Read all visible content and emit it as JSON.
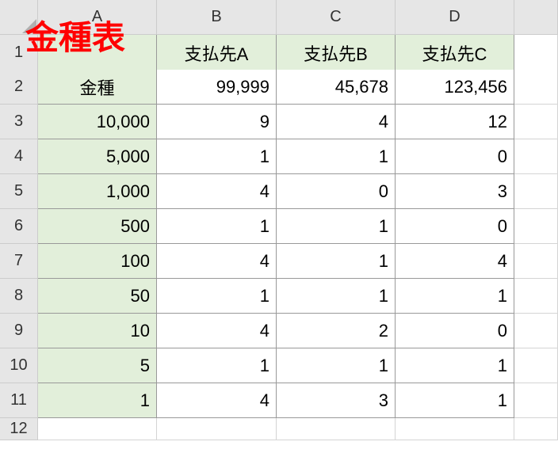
{
  "overlay_title": "金種表",
  "col_headers": [
    "A",
    "B",
    "C",
    "D"
  ],
  "row_headers": [
    "1",
    "2",
    "3",
    "4",
    "5",
    "6",
    "7",
    "8",
    "9",
    "10",
    "11",
    "12"
  ],
  "cells": {
    "B1": "支払先A",
    "C1": "支払先B",
    "D1": "支払先C",
    "A2": "金種",
    "B2": "99,999",
    "C2": "45,678",
    "D2": "123,456",
    "A3": "10,000",
    "B3": "9",
    "C3": "4",
    "D3": "12",
    "A4": "5,000",
    "B4": "1",
    "C4": "1",
    "D4": "0",
    "A5": "1,000",
    "B5": "4",
    "C5": "0",
    "D5": "3",
    "A6": "500",
    "B6": "1",
    "C6": "1",
    "D6": "0",
    "A7": "100",
    "B7": "4",
    "C7": "1",
    "D7": "4",
    "A8": "50",
    "B8": "1",
    "C8": "1",
    "D8": "1",
    "A9": "10",
    "B9": "4",
    "C9": "2",
    "D9": "0",
    "A10": "5",
    "B10": "1",
    "C10": "1",
    "D10": "1",
    "A11": "1",
    "B11": "4",
    "C11": "3",
    "D11": "1"
  }
}
